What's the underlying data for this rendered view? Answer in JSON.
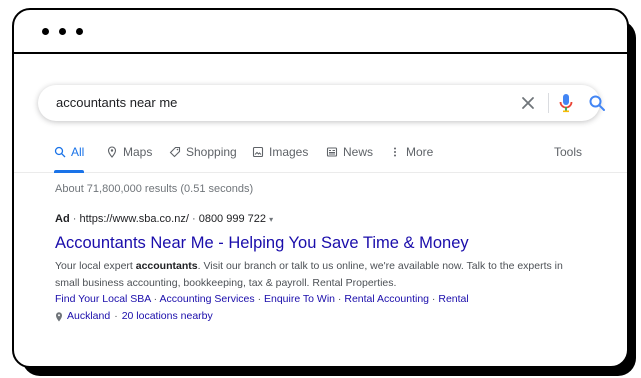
{
  "search": {
    "query": "accountants near me"
  },
  "tabs": [
    {
      "label": "All",
      "icon": "search-icon",
      "active": true
    },
    {
      "label": "Maps",
      "icon": "map-pin-icon"
    },
    {
      "label": "Shopping",
      "icon": "tag-icon"
    },
    {
      "label": "Images",
      "icon": "image-icon"
    },
    {
      "label": "News",
      "icon": "news-icon"
    },
    {
      "label": "More",
      "icon": "more-icon"
    }
  ],
  "tools_label": "Tools",
  "stats": "About 71,800,000 results (0.51 seconds)",
  "ad": {
    "badge": "Ad",
    "url": "https://www.sba.co.nz/",
    "phone": "0800 999 722",
    "title": "Accountants Near Me - Helping You Save Time & Money",
    "snippet_pre": "Your local expert ",
    "snippet_bold": "accountants",
    "snippet_post": ". Visit our branch or talk to us online, we're available now. Talk to the experts in small business accounting, bookkeeping, tax & payroll. Rental Properties.",
    "sitelinks": [
      "Find Your Local SBA",
      "Accounting Services",
      "Enquire To Win",
      "Rental Accounting",
      "Rental"
    ],
    "location": "Auckland",
    "locations_nearby": "20 locations nearby"
  },
  "colors": {
    "link": "#1a0dab",
    "accent": "#1a73e8",
    "muted": "#70757a"
  }
}
